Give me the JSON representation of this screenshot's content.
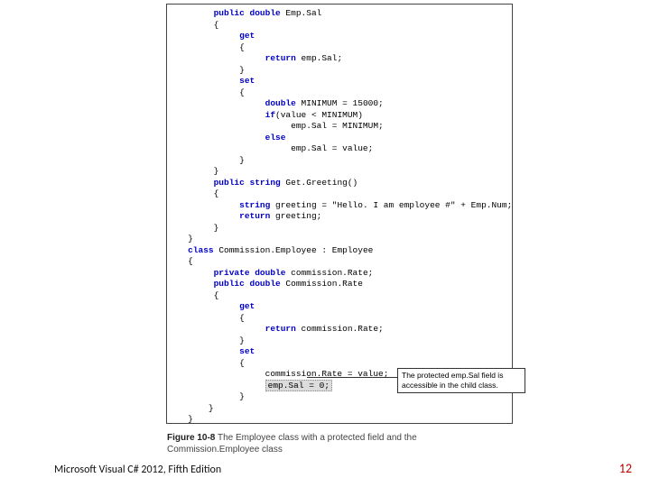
{
  "code": {
    "l1a": "        ",
    "kw1": "public double",
    "l1b": " Emp.Sal",
    "l2": "        {",
    "l3a": "             ",
    "kw3": "get",
    "l4": "             {",
    "l5a": "                  ",
    "kw5": "return",
    "l5b": " emp.Sal;",
    "l6": "             }",
    "l7a": "             ",
    "kw7": "set",
    "l8": "             {",
    "l9a": "                  ",
    "kw9a": "double",
    "l9b": " MINIMUM = 15000;",
    "l10a": "                  ",
    "kw10": "if",
    "l10b": "(value < MINIMUM)",
    "l11": "                       emp.Sal = MINIMUM;",
    "l12a": "                  ",
    "kw12": "else",
    "l13": "                       emp.Sal = value;",
    "l14": "             }",
    "l15": "        }",
    "l16a": "        ",
    "kw16": "public string",
    "l16b": " Get.Greeting()",
    "l17": "        {",
    "l18a": "             ",
    "kw18": "string",
    "l18b": " greeting = \"Hello. I am employee #\" + Emp.Num;",
    "l19a": "             ",
    "kw19": "return",
    "l19b": " greeting;",
    "l20": "        }",
    "l21": "   }",
    "l22a": "   ",
    "kw22": "class",
    "l22b": " Commission.Employee : Employee",
    "l23": "   {",
    "l24a": "        ",
    "kw24": "private double",
    "l24b": " commission.Rate;",
    "l25a": "        ",
    "kw25": "public double",
    "l25b": " Commission.Rate",
    "l26": "        {",
    "l27a": "             ",
    "kw27": "get",
    "l28": "             {",
    "l29a": "                  ",
    "kw29": "return",
    "l29b": " commission.Rate;",
    "l30": "             }",
    "l31a": "             ",
    "kw31": "set",
    "l32": "             {",
    "l33": "                  commission.Rate = value;",
    "l34": "                  ",
    "highlight": "emp.Sal = 0;",
    "l35": "             }",
    "l36": "       }",
    "l37": "   }"
  },
  "callout": "The protected emp.Sal field is accessible in the child class.",
  "caption": {
    "label": "Figure 10-8",
    "text1": " The Employee class with a protected field and the",
    "text2": "Commission.Employee class"
  },
  "footer": {
    "left": "Microsoft Visual C# 2012, Fifth Edition",
    "right": "12"
  }
}
